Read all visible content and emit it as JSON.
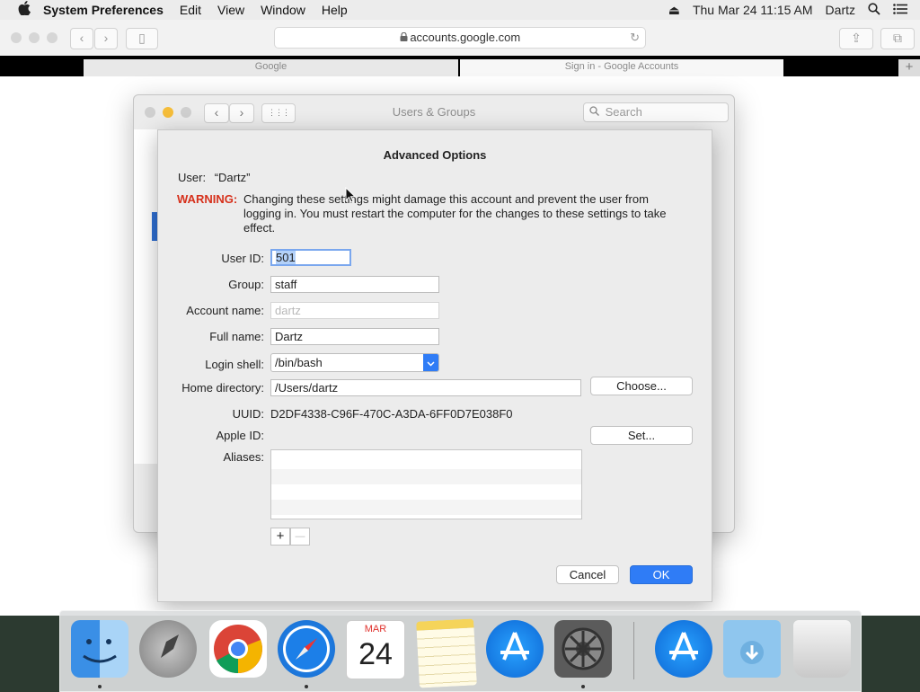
{
  "menubar": {
    "apple": "",
    "app_name": "System Preferences",
    "menus": [
      "Edit",
      "View",
      "Window",
      "Help"
    ],
    "eject": "⏏",
    "datetime": "Thu Mar 24  11:15 AM",
    "user": "Dartz",
    "search": "⌕",
    "list": "☰"
  },
  "safari": {
    "url": "accounts.google.com",
    "lock": "🔒",
    "reload": "↻",
    "tabs": [
      "Google",
      "Sign in - Google Accounts"
    ],
    "new_tab": "+"
  },
  "users_groups": {
    "title": "Users & Groups",
    "search_placeholder": "Search",
    "back": "‹",
    "forward": "›",
    "grid": "⋮⋮⋮"
  },
  "sheet": {
    "title": "Advanced Options",
    "user_label": "User:",
    "user_value": "“Dartz”",
    "warning_label": "WARNING:",
    "warning_text": "Changing these settings might damage this account and prevent the user from logging in. You must restart the computer for the changes to these settings to take effect.",
    "fields": {
      "user_id": {
        "label": "User ID:",
        "value": "501"
      },
      "group": {
        "label": "Group:",
        "value": "staff"
      },
      "account_name": {
        "label": "Account name:",
        "value": "dartz"
      },
      "full_name": {
        "label": "Full name:",
        "value": "Dartz"
      },
      "login_shell": {
        "label": "Login shell:",
        "value": "/bin/bash"
      },
      "home_directory": {
        "label": "Home directory:",
        "value": "/Users/dartz"
      },
      "uuid": {
        "label": "UUID:",
        "value": "D2DF4338-C96F-470C-A3DA-6FF0D7E038F0"
      },
      "apple_id": {
        "label": "Apple ID:",
        "value": ""
      },
      "aliases": {
        "label": "Aliases:"
      }
    },
    "choose_button": "Choose...",
    "set_button": "Set...",
    "add_button": "+",
    "remove_button": "—",
    "cancel_button": "Cancel",
    "ok_button": "OK",
    "accent_color": "#2f7cf6",
    "warning_color": "#d6301b"
  },
  "dock": {
    "calendar_month": "MAR",
    "calendar_day": "24"
  }
}
